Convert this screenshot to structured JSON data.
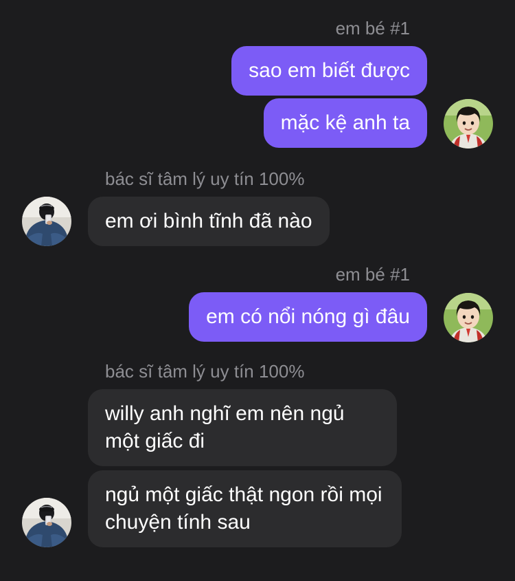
{
  "conversation": {
    "messages": [
      {
        "sender": "em bé #1",
        "side": "right",
        "avatar_icon": "child-avatar-icon",
        "bubbles": [
          "sao em biết được",
          "mặc kệ anh ta"
        ]
      },
      {
        "sender": "bác sĩ tâm lý uy tín 100%",
        "side": "left",
        "avatar_icon": "man-in-jacket-avatar-icon",
        "bubbles": [
          "em ơi bình tĩnh đã nào"
        ]
      },
      {
        "sender": "em bé #1",
        "side": "right",
        "avatar_icon": "child-avatar-icon",
        "bubbles": [
          "em có nổi nóng gì đâu"
        ]
      },
      {
        "sender": "bác sĩ tâm lý uy tín 100%",
        "side": "left",
        "avatar_icon": "man-in-jacket-avatar-icon",
        "bubbles": [
          "willy anh nghĩ em nên ngủ một giấc đi",
          "ngủ một giấc thật ngon rồi mọi chuyện tính sau"
        ]
      }
    ]
  },
  "colors": {
    "background": "#1c1c1e",
    "outgoing_bubble": "#7c5cf6",
    "incoming_bubble": "#2c2c2e",
    "sender_name": "#8e8e93",
    "text": "#ffffff"
  }
}
